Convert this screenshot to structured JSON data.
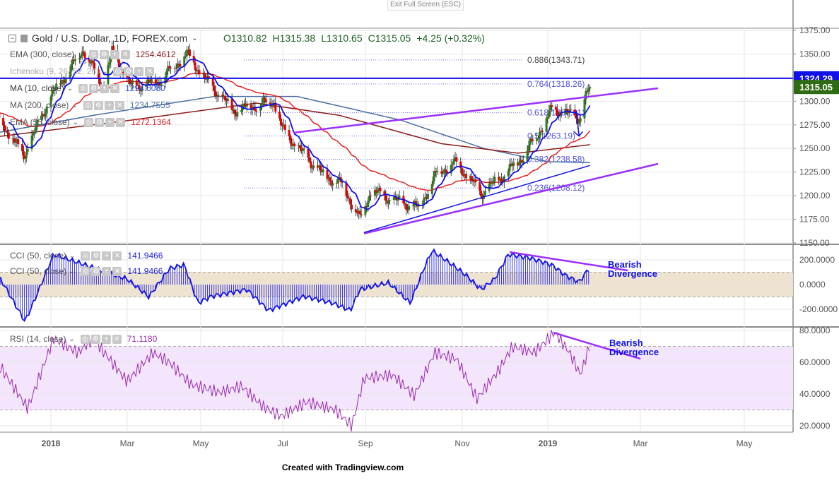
{
  "top": {
    "exit_full_screen": "Exit Full Screen (ESC)"
  },
  "header": {
    "symbol": "Gold / U.S. Dollar, 1D, FOREX.com",
    "open": "O1310.82",
    "high": "H1315.38",
    "low": "L1310.65",
    "close": "C1315.05",
    "change": "+4.25 (+0.32%)"
  },
  "legend": [
    {
      "label": "EMA (300, close)",
      "value": "1254.4612",
      "color": "#8b1a1a"
    },
    {
      "label": "Ichimoku (9, 26, 52, 26)",
      "value": "",
      "color": "#aaa"
    },
    {
      "label": "MA (10, close)",
      "value": "1294.6080",
      "color": "#2f4fd8"
    },
    {
      "label": "MA (200, close)",
      "value": "1234.7555",
      "color": "#4a6fa5"
    },
    {
      "label": "EMA (55, close)",
      "value": "1272.1364",
      "color": "#e02020"
    }
  ],
  "cci_legend": [
    {
      "label": "CCI (50, close)",
      "value": "141.9466"
    },
    {
      "label": "CCI (50, close)",
      "value": "141.9466"
    }
  ],
  "rsi_legend": {
    "label": "RSI (14, close)",
    "value": "71.1180"
  },
  "price_axis": {
    "ticks": [
      "1375.00",
      "1350.00",
      "1325.00",
      "1300.00",
      "1275.00",
      "1250.00",
      "1225.00",
      "1200.00",
      "1175.00",
      "1150.00"
    ],
    "horizontal_line": "1324.29",
    "last_price": "1315.05"
  },
  "cci_axis": [
    "200.0000",
    "0.0000",
    "-200.0000"
  ],
  "rsi_axis": [
    "80.0000",
    "60.0000",
    "40.0000",
    "20.0000"
  ],
  "time_axis": [
    "2018",
    "Mar",
    "May",
    "Jul",
    "Sep",
    "Nov",
    "2019",
    "Mar",
    "May"
  ],
  "annotations": {
    "cci": [
      "Bearish",
      "Divergence"
    ],
    "rsi": [
      "Bearish",
      "Divergence"
    ]
  },
  "credit": "Created with Tradingview.com",
  "colors": {
    "up": "#2e7d1e",
    "down": "#e80000",
    "ma10": "#1010e8",
    "ema55": "#e82020",
    "ema300": "#8b1a1a",
    "ma200": "#4a6fa5",
    "trend": "#9b30ff",
    "hline": "#1010e8"
  },
  "chart_data": {
    "type": "line",
    "title": "Gold / U.S. Dollar, 1D, FOREX.com",
    "ylim": [
      1150,
      1375
    ],
    "price_path": [
      [
        "2017-11-20",
        1290
      ],
      [
        "2017-12-12",
        1242
      ],
      [
        "2018-01-01",
        1305
      ],
      [
        "2018-01-25",
        1355
      ],
      [
        "2018-02-08",
        1315
      ],
      [
        "2018-02-15",
        1352
      ],
      [
        "2018-03-01",
        1315
      ],
      [
        "2018-03-20",
        1320
      ],
      [
        "2018-04-11",
        1350
      ],
      [
        "2018-04-25",
        1322
      ],
      [
        "2018-05-15",
        1290
      ],
      [
        "2018-06-14",
        1300
      ],
      [
        "2018-06-20",
        1270
      ],
      [
        "2018-07-03",
        1248
      ],
      [
        "2018-07-20",
        1222
      ],
      [
        "2018-08-03",
        1212
      ],
      [
        "2018-08-16",
        1175
      ],
      [
        "2018-08-24",
        1205
      ],
      [
        "2018-09-10",
        1195
      ],
      [
        "2018-09-28",
        1187
      ],
      [
        "2018-10-12",
        1225
      ],
      [
        "2018-10-26",
        1235
      ],
      [
        "2018-11-13",
        1202
      ],
      [
        "2018-11-30",
        1222
      ],
      [
        "2018-12-14",
        1242
      ],
      [
        "2018-12-31",
        1280
      ],
      [
        "2019-01-04",
        1292
      ],
      [
        "2019-01-25",
        1282
      ],
      [
        "2019-01-29",
        1305
      ],
      [
        "2019-02-01",
        1315
      ]
    ],
    "ema300": [
      [
        "2017-11-20",
        1262
      ],
      [
        "2018-03-01",
        1280
      ],
      [
        "2018-06-01",
        1298
      ],
      [
        "2018-08-01",
        1285
      ],
      [
        "2018-10-15",
        1255
      ],
      [
        "2018-12-10",
        1245
      ],
      [
        "2019-02-01",
        1254
      ]
    ],
    "ma200": [
      [
        "2017-11-20",
        1266
      ],
      [
        "2018-02-01",
        1285
      ],
      [
        "2018-05-01",
        1305
      ],
      [
        "2018-07-01",
        1305
      ],
      [
        "2018-09-15",
        1280
      ],
      [
        "2018-11-15",
        1250
      ],
      [
        "2019-01-01",
        1236
      ],
      [
        "2019-02-01",
        1235
      ]
    ],
    "fibonacci": [
      {
        "ratio": "0.886",
        "price": 1343.71
      },
      {
        "ratio": "0.764",
        "price": 1318.26
      },
      {
        "ratio": "0.618",
        "price": 1287.81
      },
      {
        "ratio": "0.5",
        "price": 1263.19
      },
      {
        "ratio": "0.382",
        "price": 1238.58
      },
      {
        "ratio": "0.236",
        "price": 1208.12
      }
    ],
    "trendlines": [
      [
        [
          "2018-06-28",
          1266.6
        ],
        [
          "2019-03-23",
          1313.7
        ]
      ],
      [
        [
          "2018-08-19",
          1160
        ],
        [
          "2019-03-23",
          1233.7
        ]
      ]
    ],
    "cci": [
      [
        "2017-11-25",
        45
      ],
      [
        "2017-12-13",
        -300
      ],
      [
        "2017-12-21",
        -100
      ],
      [
        "2018-01-03",
        245
      ],
      [
        "2018-01-26",
        160
      ],
      [
        "2018-02-10",
        100
      ],
      [
        "2018-02-26",
        45
      ],
      [
        "2018-03-14",
        -100
      ],
      [
        "2018-03-29",
        130
      ],
      [
        "2018-04-09",
        160
      ],
      [
        "2018-04-19",
        -150
      ],
      [
        "2018-04-29",
        -95
      ],
      [
        "2018-05-25",
        -40
      ],
      [
        "2018-06-10",
        -210
      ],
      [
        "2018-07-06",
        -95
      ],
      [
        "2018-07-27",
        -150
      ],
      [
        "2018-08-09",
        -210
      ],
      [
        "2018-08-16",
        -40
      ],
      [
        "2018-09-06",
        15
      ],
      [
        "2018-09-22",
        -150
      ],
      [
        "2018-10-02",
        130
      ],
      [
        "2018-10-08",
        275
      ],
      [
        "2018-10-23",
        160
      ],
      [
        "2018-11-02",
        75
      ],
      [
        "2018-11-13",
        -40
      ],
      [
        "2018-11-23",
        45
      ],
      [
        "2018-12-03",
        245
      ],
      [
        "2018-12-19",
        215
      ],
      [
        "2019-01-04",
        160
      ],
      [
        "2019-01-14",
        75
      ],
      [
        "2019-01-24",
        20
      ],
      [
        "2019-02-01",
        142
      ]
    ],
    "cci_divergence": [
      [
        "2018-12-04",
        263
      ],
      [
        "2019-03-01",
        114
      ]
    ],
    "rsi": [
      [
        "2017-11-25",
        57
      ],
      [
        "2017-12-15",
        31
      ],
      [
        "2018-01-03",
        75
      ],
      [
        "2018-01-21",
        66
      ],
      [
        "2018-02-01",
        75
      ],
      [
        "2018-02-26",
        48
      ],
      [
        "2018-03-17",
        66
      ],
      [
        "2018-03-29",
        60
      ],
      [
        "2018-04-14",
        46
      ],
      [
        "2018-05-05",
        41
      ],
      [
        "2018-05-21",
        45
      ],
      [
        "2018-06-06",
        32
      ],
      [
        "2018-06-19",
        26
      ],
      [
        "2018-07-08",
        35
      ],
      [
        "2018-07-29",
        30
      ],
      [
        "2018-08-10",
        20
      ],
      [
        "2018-08-19",
        50
      ],
      [
        "2018-09-09",
        52
      ],
      [
        "2018-09-25",
        39
      ],
      [
        "2018-10-10",
        66
      ],
      [
        "2018-10-26",
        62
      ],
      [
        "2018-11-10",
        37
      ],
      [
        "2018-11-26",
        55
      ],
      [
        "2018-12-06",
        70
      ],
      [
        "2018-12-22",
        66
      ],
      [
        "2019-01-06",
        79
      ],
      [
        "2019-01-17",
        66
      ],
      [
        "2019-01-25",
        52
      ],
      [
        "2019-02-01",
        71
      ]
    ],
    "rsi_divergence": [
      [
        "2019-01-05",
        78.7
      ],
      [
        "2019-03-10",
        62.2
      ]
    ]
  }
}
